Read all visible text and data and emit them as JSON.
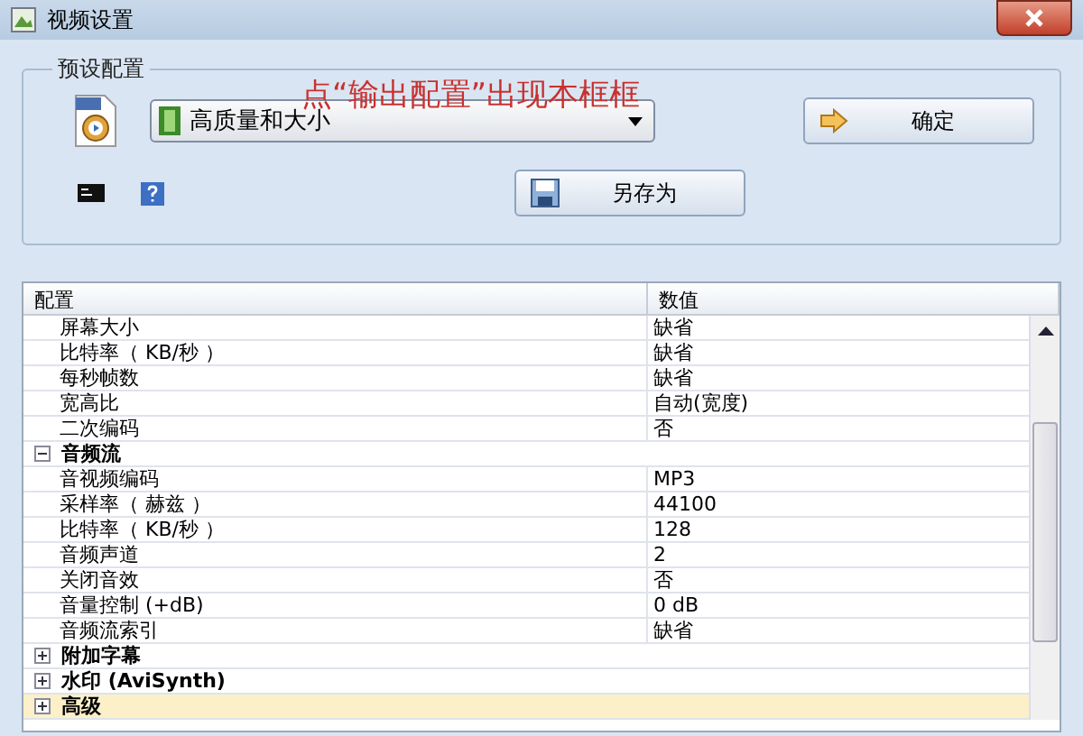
{
  "window": {
    "title": "视频设置"
  },
  "annotation": "点“输出配置”出现本框框",
  "preset": {
    "legend": "预设配置",
    "dropdown": {
      "value": "高质量和大小"
    },
    "ok_button": "确定",
    "save_as_button": "另存为"
  },
  "table": {
    "columns": [
      "配置",
      "数值"
    ],
    "rows": [
      {
        "kind": "property",
        "name": "屏幕大小",
        "value": "缺省"
      },
      {
        "kind": "property",
        "name": "比特率（ KB/秒 ）",
        "value": "缺省"
      },
      {
        "kind": "property",
        "name": "每秒帧数",
        "value": "缺省"
      },
      {
        "kind": "property",
        "name": "宽高比",
        "value": "自动(宽度)"
      },
      {
        "kind": "property",
        "name": "二次编码",
        "value": "否"
      },
      {
        "kind": "group",
        "name": "音频流",
        "expanded": true,
        "selected": false
      },
      {
        "kind": "property",
        "name": "音视频编码",
        "value": "MP3"
      },
      {
        "kind": "property",
        "name": "采样率（ 赫兹 ）",
        "value": "44100"
      },
      {
        "kind": "property",
        "name": "比特率（ KB/秒 ）",
        "value": "128"
      },
      {
        "kind": "property",
        "name": "音频声道",
        "value": "2"
      },
      {
        "kind": "property",
        "name": "关闭音效",
        "value": "否"
      },
      {
        "kind": "property",
        "name": "音量控制 (+dB)",
        "value": "0 dB"
      },
      {
        "kind": "property",
        "name": "音频流索引",
        "value": "缺省"
      },
      {
        "kind": "group",
        "name": "附加字幕",
        "expanded": false,
        "selected": false
      },
      {
        "kind": "group",
        "name": "水印 (AviSynth)",
        "expanded": false,
        "selected": false
      },
      {
        "kind": "group",
        "name": "高级",
        "expanded": false,
        "selected": true
      }
    ]
  }
}
